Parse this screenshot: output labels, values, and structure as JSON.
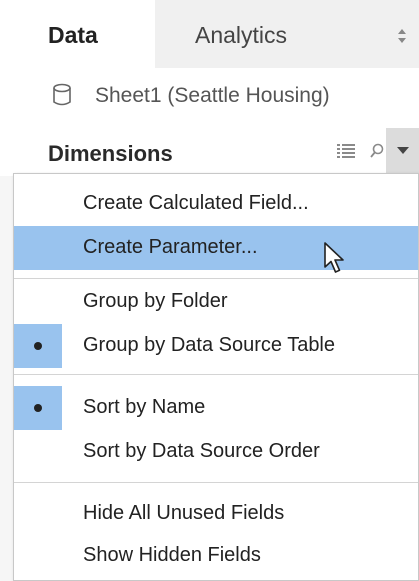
{
  "tabs": {
    "data_label": "Data",
    "analytics_label": "Analytics",
    "toggle_icon": "up-down-arrows-icon"
  },
  "datasource": {
    "label": "Sheet1 (Seattle Housing)",
    "icon": "database-icon"
  },
  "dimensions": {
    "label": "Dimensions",
    "icons": [
      "grid-icon",
      "search-icon",
      "chevron-down-icon"
    ]
  },
  "menu": {
    "items": [
      {
        "label": "Create Calculated Field...",
        "checked": false,
        "highlighted": false
      },
      {
        "label": "Create Parameter...",
        "checked": false,
        "highlighted": true
      },
      {
        "label": "Group by Folder",
        "checked": false,
        "highlighted": false
      },
      {
        "label": "Group by Data Source Table",
        "checked": true,
        "highlighted": false
      },
      {
        "label": "Sort by Name",
        "checked": true,
        "highlighted": false
      },
      {
        "label": "Sort by Data Source Order",
        "checked": false,
        "highlighted": false
      },
      {
        "label": "Hide All Unused Fields",
        "checked": false,
        "highlighted": false
      },
      {
        "label": "Show Hidden Fields",
        "checked": false,
        "highlighted": false
      }
    ]
  },
  "colors": {
    "highlight": "#99c3ee",
    "panel_bg": "#ffffff",
    "tab_bg": "#f0f0f0"
  }
}
